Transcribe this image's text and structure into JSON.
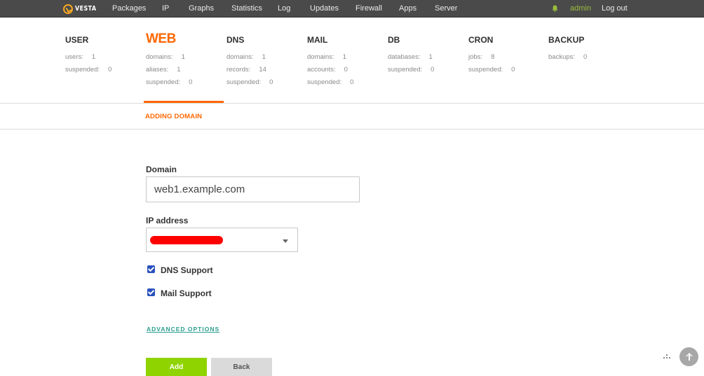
{
  "brand": {
    "name": "VESTA",
    "accent": "#ff6701",
    "logo_color": "#f5a623"
  },
  "topnav": {
    "items": [
      "Packages",
      "IP",
      "Graphs",
      "Statistics",
      "Log",
      "Updates",
      "Firewall",
      "Apps",
      "Server"
    ],
    "user": "admin",
    "logout": "Log out"
  },
  "stats": [
    {
      "title": "USER",
      "rows": [
        {
          "label": "users:",
          "value": "1"
        },
        {
          "label": "suspended:",
          "value": "0"
        }
      ]
    },
    {
      "title": "WEB",
      "rows": [
        {
          "label": "domains:",
          "value": "1"
        },
        {
          "label": "aliases:",
          "value": "1"
        },
        {
          "label": "suspended:",
          "value": "0"
        }
      ]
    },
    {
      "title": "DNS",
      "rows": [
        {
          "label": "domains:",
          "value": "1"
        },
        {
          "label": "records:",
          "value": "14"
        },
        {
          "label": "suspended:",
          "value": "0"
        }
      ]
    },
    {
      "title": "MAIL",
      "rows": [
        {
          "label": "domains:",
          "value": "1"
        },
        {
          "label": "accounts:",
          "value": "0"
        },
        {
          "label": "suspended:",
          "value": "0"
        }
      ]
    },
    {
      "title": "DB",
      "rows": [
        {
          "label": "databases:",
          "value": "1"
        },
        {
          "label": "suspended:",
          "value": "0"
        }
      ]
    },
    {
      "title": "CRON",
      "rows": [
        {
          "label": "jobs:",
          "value": "8"
        },
        {
          "label": "suspended:",
          "value": "0"
        }
      ]
    },
    {
      "title": "BACKUP",
      "rows": [
        {
          "label": "backups:",
          "value": "0"
        }
      ]
    }
  ],
  "tab": {
    "crumb": "ADDING DOMAIN"
  },
  "form": {
    "domain_label": "Domain",
    "domain_value": "web1.example.com",
    "ip_label": "IP address",
    "dns_support": "DNS Support",
    "mail_support": "Mail Support",
    "advanced": "ADVANCED OPTIONS",
    "add": "Add",
    "back": "Back"
  }
}
